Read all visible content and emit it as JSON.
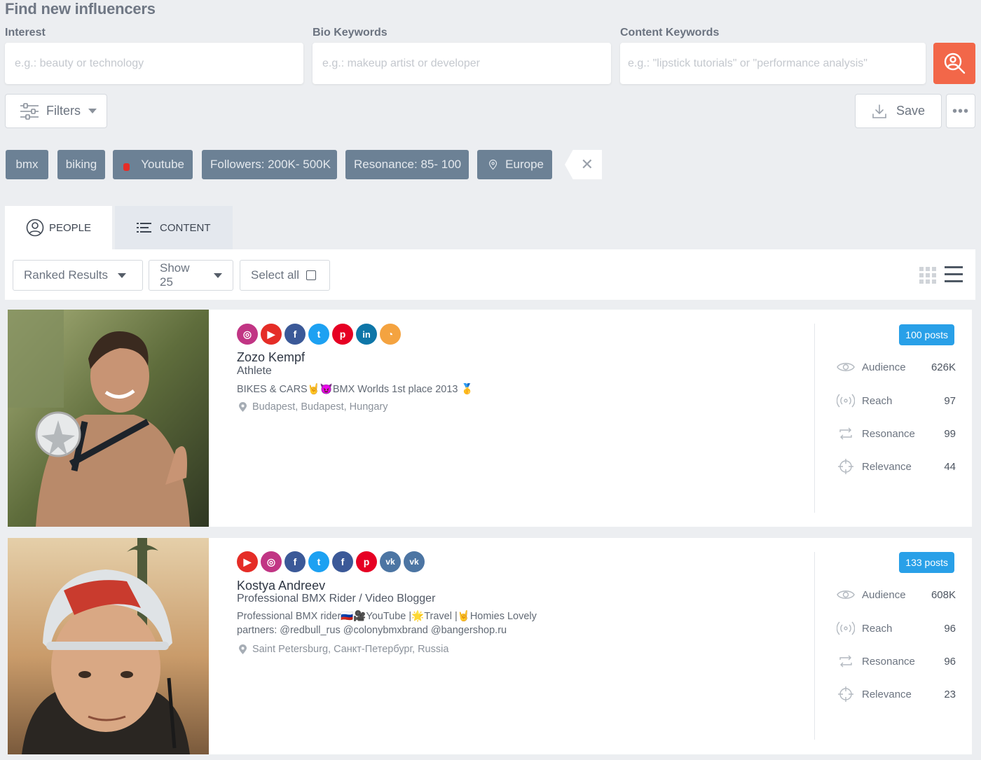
{
  "page_title": "Find new influencers",
  "search": {
    "interest_label": "Interest",
    "interest_placeholder": "e.g.: beauty or technology",
    "bio_label": "Bio Keywords",
    "bio_placeholder": "e.g.: makeup artist or developer",
    "content_label": "Content Keywords",
    "content_placeholder": "e.g.: \"lipstick tutorials\" or \"performance analysis\"",
    "search_icon": "search-person-icon"
  },
  "actions": {
    "filters_label": "Filters",
    "save_label": "Save",
    "more_icon": "more-horizontal-icon"
  },
  "active_filters": [
    "bmx",
    "biking",
    "Youtube",
    "Followers: 200K- 500K",
    "Resonance: 85- 100",
    "Europe"
  ],
  "tabs": [
    {
      "label": "PEOPLE",
      "icon": "person-icon",
      "active": true
    },
    {
      "label": "CONTENT",
      "icon": "list-icon",
      "active": false
    }
  ],
  "toolbar": {
    "sort_label": "Ranked Results",
    "show_label": "Show 25",
    "select_all_label": "Select all",
    "view_icons": [
      "grid-view-icon",
      "list-view-icon"
    ]
  },
  "colors": {
    "accent": "#f26749",
    "chip": "#6c8195",
    "posts_badge": "#29a0e8"
  },
  "stat_labels": {
    "audience": "Audience",
    "reach": "Reach",
    "resonance": "Resonance",
    "relevance": "Relevance"
  },
  "influencers": [
    {
      "name": "Zozo Kempf",
      "role": "Athlete",
      "bio": "BIKES & CARS🤘😈BMX Worlds 1st place 2013 🥇",
      "location": "Budapest, Budapest, Hungary",
      "posts": "100 posts",
      "audience": "626K",
      "reach": "97",
      "resonance": "99",
      "relevance": "44",
      "socials": [
        "instagram",
        "youtube",
        "facebook",
        "twitter",
        "pinterest",
        "linkedin",
        "rss"
      ]
    },
    {
      "name": "Kostya Andreev",
      "role": "Professional BMX Rider / Video Blogger",
      "bio": "Professional BMX rider🇷🇺🎥YouTube |🌟Travel |🤘Homies Lovely partners: @redbull_rus @colonybmxbrand @bangershop.ru",
      "location": "Saint Petersburg, Санкт-Петербург, Russia",
      "posts": "133 posts",
      "audience": "608K",
      "reach": "96",
      "resonance": "96",
      "relevance": "23",
      "socials": [
        "youtube",
        "instagram",
        "facebook",
        "twitter",
        "facebook",
        "pinterest",
        "vk",
        "vk"
      ]
    }
  ]
}
